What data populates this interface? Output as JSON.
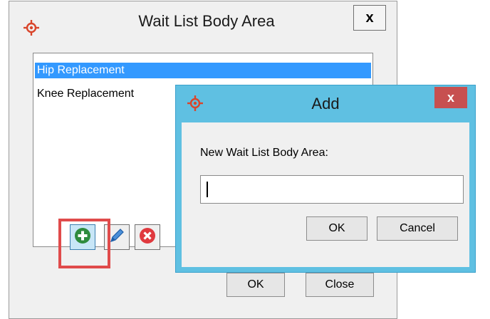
{
  "main_dialog": {
    "title": "Wait List Body Area",
    "close_label": "x",
    "list_items": [
      {
        "label": "Hip Replacement",
        "selected": true
      },
      {
        "label": "Knee Replacement",
        "selected": false
      }
    ],
    "buttons": {
      "ok": "OK",
      "close": "Close"
    }
  },
  "add_dialog": {
    "title": "Add",
    "close_label": "x",
    "field_label": "New Wait List Body Area:",
    "field_value": "",
    "buttons": {
      "ok": "OK",
      "cancel": "Cancel"
    }
  },
  "icons": {
    "logo": "crosshair-logo-icon",
    "add": "plus-circle-icon",
    "edit": "pencil-icon",
    "delete": "x-circle-icon"
  },
  "colors": {
    "selection": "#3399ff",
    "add_dialog_titlebar": "#5fc0e2",
    "add_dialog_close": "#c75050",
    "highlight": "#e04b4b",
    "logo": "#d9452b"
  }
}
